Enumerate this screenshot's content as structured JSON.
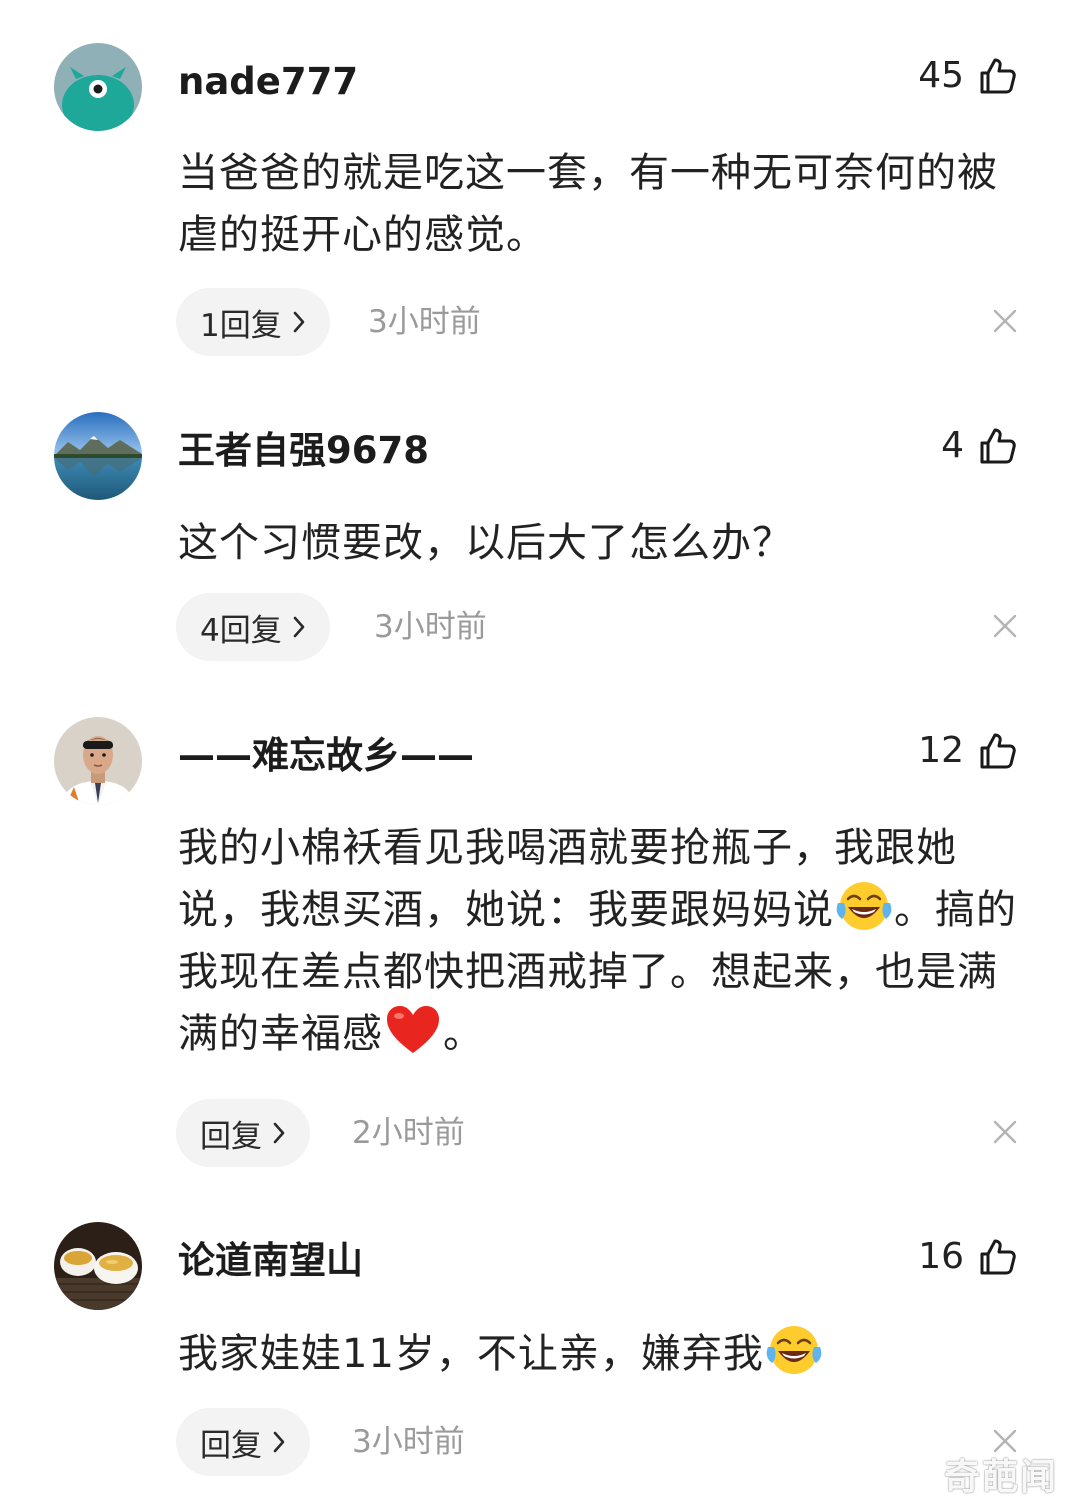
{
  "comments": [
    {
      "username": "nade777",
      "likes": "45",
      "avatar": "teal-monster-avatar",
      "text_parts": [
        "当爸爸的就是吃这一套，有一种无可奈何的被虐的挺开心的感觉。"
      ],
      "reply_label": "1回复",
      "time": "3小时前"
    },
    {
      "username": "王者自强9678",
      "likes": "4",
      "avatar": "lake-mountain-avatar",
      "text_parts": [
        "这个习惯要改，以后大了怎么办？"
      ],
      "reply_label": "4回复",
      "time": "3小时前"
    },
    {
      "username": "——难忘故乡——",
      "likes": "12",
      "avatar": "man-portrait-avatar",
      "text_parts": [
        "我的小棉袄看见我喝酒就要抢瓶子，我跟她说，我想买酒，她说：我要跟妈妈说",
        "。搞的我现在差点都快把酒戒掉了。想起来，也是满满的幸福感",
        "。"
      ],
      "emojis": [
        "laughing-crying-emoji",
        "red-heart-emoji"
      ],
      "reply_label": "回复",
      "time": "2小时前"
    },
    {
      "username": "论道南望山",
      "likes": "16",
      "avatar": "tea-cups-avatar",
      "text_parts": [
        "我家娃娃11岁，不让亲，嫌弃我"
      ],
      "emojis": [
        "laughing-crying-emoji"
      ],
      "reply_label": "回复",
      "time": "3小时前"
    }
  ],
  "icons": {
    "like": "thumbs-up-icon",
    "chevron": "chevron-right-icon",
    "close": "close-icon"
  },
  "watermark": "奇葩闻",
  "colors": {
    "text": "#222222",
    "muted": "#9a9a9a",
    "pill_bg": "#f3f3f3"
  }
}
